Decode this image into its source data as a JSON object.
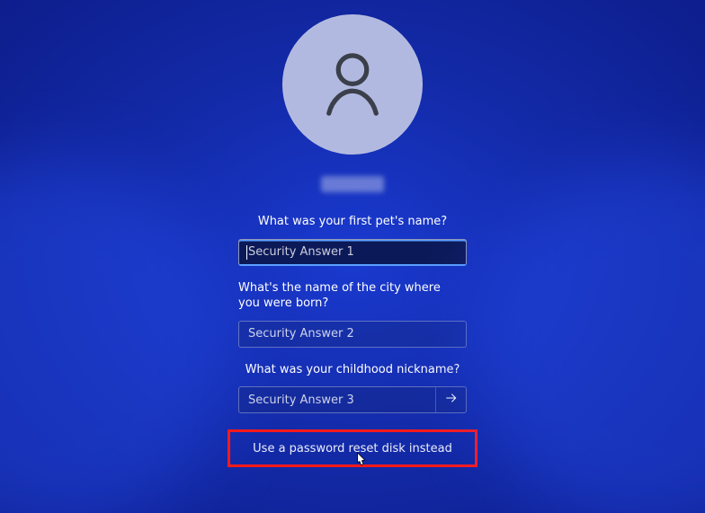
{
  "avatar": {
    "icon": "person-icon"
  },
  "username": "",
  "questions": {
    "q1": {
      "prompt": "What was your first pet's name?",
      "placeholder": "Security Answer 1",
      "value": ""
    },
    "q2": {
      "prompt": "What's the name of the city where you were born?",
      "placeholder": "Security Answer 2",
      "value": ""
    },
    "q3": {
      "prompt": "What was your childhood nickname?",
      "placeholder": "Security Answer 3",
      "value": ""
    }
  },
  "reset_link": "Use a password reset disk instead",
  "highlight": {
    "color": "#ff1a1a",
    "target": "reset-disk-link"
  }
}
